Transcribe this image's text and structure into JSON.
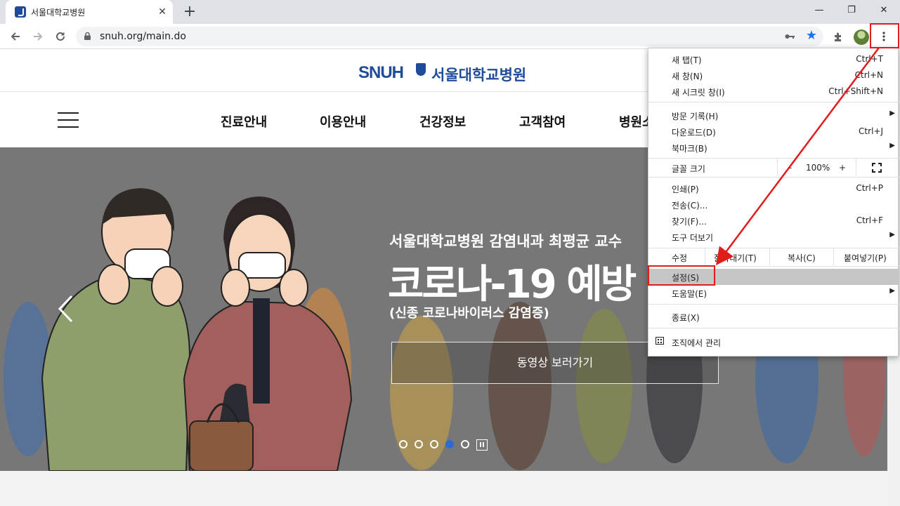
{
  "browser": {
    "tab_title": "서울대학교병원",
    "tab_close": "✕",
    "new_tab": "+",
    "url": "snuh.org/main.do",
    "window_controls": [
      "—",
      "❐",
      "✕"
    ]
  },
  "site": {
    "logo_en": "SNUH",
    "logo_ko": "서울대학교병원",
    "nav": [
      "진료안내",
      "이용안내",
      "건강정보",
      "고객참여",
      "병원소"
    ]
  },
  "hero": {
    "subtitle": "서울대학교병원 감염내과 최평균 교수",
    "headline": "코로나-19 예방",
    "subtitle2": "(신종 코로나바이러스 감염증)",
    "video_button": "동영상 보러가기",
    "slide_count": 5,
    "active_slide": 4
  },
  "menu": {
    "items": [
      {
        "label": "새 탭(T)",
        "shortcut": "Ctrl+T"
      },
      {
        "label": "새 창(N)",
        "shortcut": "Ctrl+N"
      },
      {
        "label": "새 시크릿 창(I)",
        "shortcut": "Ctrl+Shift+N"
      },
      {
        "label": "방문 기록(H)",
        "shortcut": ""
      },
      {
        "label": "다운로드(D)",
        "shortcut": "Ctrl+J"
      },
      {
        "label": "북마크(B)",
        "shortcut": ""
      },
      {
        "label": "인쇄(P)",
        "shortcut": "Ctrl+P"
      },
      {
        "label": "전송(C)...",
        "shortcut": ""
      },
      {
        "label": "찾기(F)...",
        "shortcut": "Ctrl+F"
      },
      {
        "label": "도구 더보기",
        "shortcut": ""
      },
      {
        "label": "설정(S)",
        "shortcut": ""
      },
      {
        "label": "도움말(E)",
        "shortcut": ""
      },
      {
        "label": "종료(X)",
        "shortcut": ""
      },
      {
        "label": "조직에서 관리",
        "shortcut": ""
      }
    ],
    "zoom": {
      "label": "글꼴 크기",
      "minus": "–",
      "value": "100%",
      "plus": "+"
    },
    "edit": {
      "label": "수정",
      "cut": "잘라내기(T)",
      "copy": "복사(C)",
      "paste": "붙여넣기(P)"
    },
    "submenu_arrow": "▶"
  },
  "colors": {
    "brand": "#1f4b99",
    "accent_star": "#1a73e8",
    "annotation": "#e21b1b",
    "active_dot": "#2f6bd1"
  }
}
